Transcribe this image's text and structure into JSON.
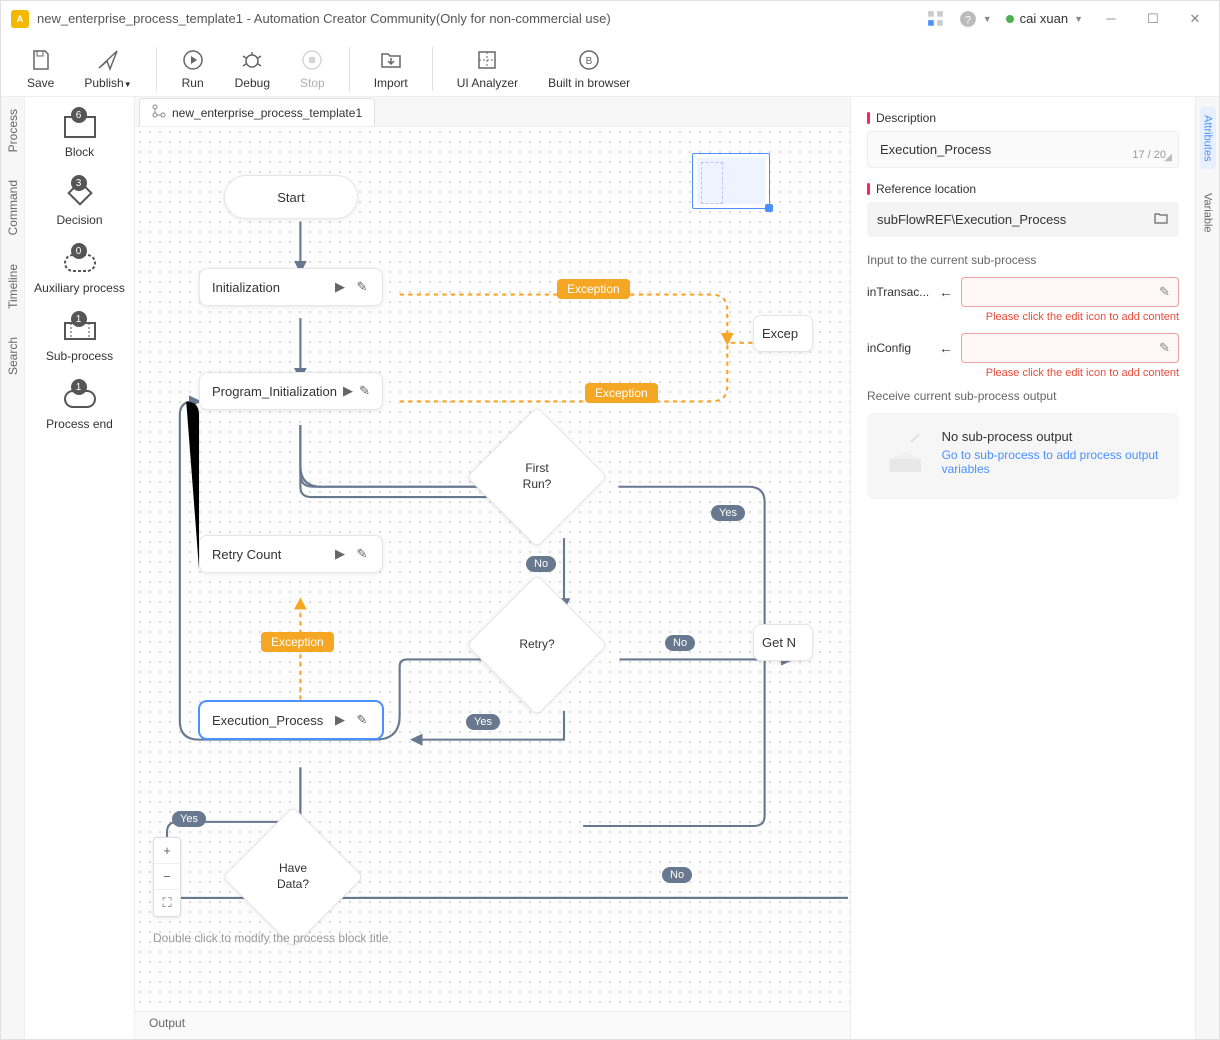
{
  "titlebar": {
    "title": "new_enterprise_process_template1 - Automation Creator Community(Only for non-commercial use)",
    "user": "cai xuan"
  },
  "toolbar": {
    "save": "Save",
    "publish": "Publish",
    "run": "Run",
    "debug": "Debug",
    "stop": "Stop",
    "import": "Import",
    "ui_analyzer": "UI Analyzer",
    "browser": "Built in browser"
  },
  "leftstrip": {
    "process": "Process",
    "command": "Command",
    "timeline": "Timeline",
    "search": "Search"
  },
  "palette": {
    "block": {
      "label": "Block",
      "badge": "6"
    },
    "decision": {
      "label": "Decision",
      "badge": "3"
    },
    "aux": {
      "label": "Auxiliary process",
      "badge": "0"
    },
    "subprocess": {
      "label": "Sub-process",
      "badge": "1"
    },
    "end": {
      "label": "Process end",
      "badge": "1"
    }
  },
  "tab": {
    "label": "new_enterprise_process_template1"
  },
  "flow": {
    "start": "Start",
    "init": "Initialization",
    "prog_init": "Program_Initialization",
    "retry_count": "Retry Count",
    "exec_process": "Execution_Process",
    "first_run": "First\nRun?",
    "retry": "Retry?",
    "have_data": "Have\nData?",
    "excep_node": "Excep",
    "get_node": "Get N",
    "exception": "Exception",
    "yes": "Yes",
    "no": "No"
  },
  "hint": "Double click to modify the process block title",
  "right": {
    "desc_label": "Description",
    "desc_value": "Execution_Process",
    "desc_count": "17 / 20",
    "ref_label": "Reference location",
    "ref_value": "subFlowREF\\Execution_Process",
    "input_section": "Input to the current sub-process",
    "input1_label": "inTransac...",
    "input2_label": "inConfig",
    "err": "Please click the edit icon to add content",
    "output_section": "Receive current sub-process output",
    "no_output": "No sub-process output",
    "output_link": "Go to sub-process to add process output variables"
  },
  "rightstrip": {
    "attributes": "Attributes",
    "variable": "Variable"
  },
  "bottom": {
    "output": "Output"
  }
}
